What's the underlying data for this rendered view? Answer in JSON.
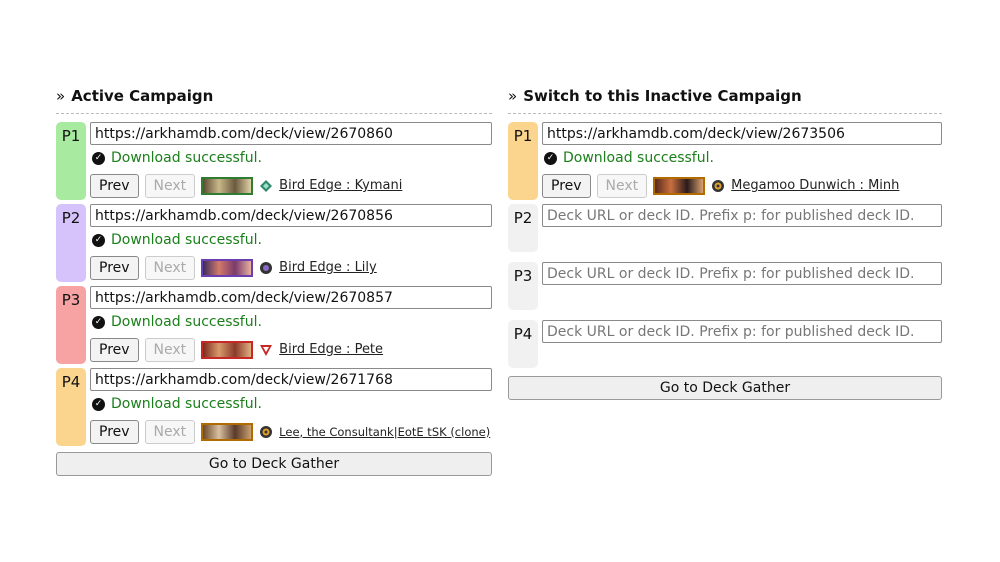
{
  "active": {
    "title": "Active Campaign",
    "players": [
      {
        "label": "P1",
        "color": "#a7eaa0",
        "url": "https://arkhamdb.com/deck/view/2670860",
        "status": "Download successful.",
        "prev": "Prev",
        "next": "Next",
        "deck": "Bird Edge : Kymani",
        "class_icon": "guardian-icon",
        "thumb_border": "#2e7d32"
      },
      {
        "label": "P2",
        "color": "#d6c3fb",
        "url": "https://arkhamdb.com/deck/view/2670856",
        "status": "Download successful.",
        "prev": "Prev",
        "next": "Next",
        "deck": "Bird Edge : Lily",
        "class_icon": "mystic-icon",
        "thumb_border": "#6a3fb0"
      },
      {
        "label": "P3",
        "color": "#f7a3a3",
        "url": "https://arkhamdb.com/deck/view/2670857",
        "status": "Download successful.",
        "prev": "Prev",
        "next": "Next",
        "deck": "Bird Edge : Pete",
        "class_icon": "survivor-icon",
        "thumb_border": "#c62828"
      },
      {
        "label": "P4",
        "color": "#fbd58d",
        "url": "https://arkhamdb.com/deck/view/2671768",
        "status": "Download successful.",
        "prev": "Prev",
        "next": "Next",
        "deck": "Lee, the Consultank|EotE tSK (clone)",
        "class_icon": "seeker-icon",
        "thumb_border": "#b26b00"
      }
    ],
    "gather_label": "Go to Deck Gather"
  },
  "inactive": {
    "title": "Switch to this Inactive Campaign",
    "players": [
      {
        "label": "P1",
        "color": "#fbd58d",
        "url": "https://arkhamdb.com/deck/view/2673506",
        "status": "Download successful.",
        "prev": "Prev",
        "next": "Next",
        "deck": "Megamoo Dunwich : Minh",
        "class_icon": "seeker-icon",
        "thumb_border": "#b26b00"
      },
      {
        "label": "P2",
        "color": "#f1f1f1",
        "url": "",
        "placeholder": "Deck URL or deck ID. Prefix p: for published deck ID."
      },
      {
        "label": "P3",
        "color": "#f1f1f1",
        "url": "",
        "placeholder": "Deck URL or deck ID. Prefix p: for published deck ID."
      },
      {
        "label": "P4",
        "color": "#f1f1f1",
        "url": "",
        "placeholder": "Deck URL or deck ID. Prefix p: for published deck ID."
      }
    ],
    "gather_label": "Go to Deck Gather"
  },
  "chevron": "»",
  "check_glyph": "✓"
}
